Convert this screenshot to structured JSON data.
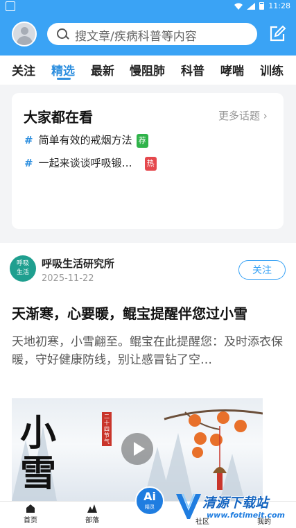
{
  "status_bar": {
    "time": "11:28"
  },
  "header": {
    "search_placeholder": "搜文章/疾病科普等内容",
    "icons": [
      "avatar",
      "search-icon",
      "edit-icon"
    ]
  },
  "tabs": [
    {
      "label": "关注",
      "active": false
    },
    {
      "label": "精选",
      "active": true
    },
    {
      "label": "最新",
      "active": false
    },
    {
      "label": "慢阻肺",
      "active": false
    },
    {
      "label": "科普",
      "active": false
    },
    {
      "label": "哮喘",
      "active": false
    },
    {
      "label": "训练",
      "active": false
    }
  ],
  "trending": {
    "title": "大家都在看",
    "more_label": "更多话题 ›",
    "topics": [
      {
        "hash": "#",
        "text": "简单有效的戒烟方法",
        "badge": "荐",
        "badge_color": "#2fb34a"
      },
      {
        "hash": "#",
        "text": "一起来谈谈呼吸锻…",
        "badge": "热",
        "badge_color": "#e5484d"
      }
    ]
  },
  "post": {
    "author_logo": "呼吸\n生活",
    "author": "呼吸生活研究所",
    "date": "2025-11-22",
    "follow_label": "关注",
    "title": "天渐寒，心要暖，鲲宝提醒伴您过小雪",
    "excerpt": "天地初寒，小雪翩至。鲲宝在此提醒您：及时添衣保暖，守好健康防线，别让感冒钻了空…",
    "image_calligraphy": "小雪",
    "image_stamp": "二十四节气"
  },
  "bottom_nav": {
    "items": [
      {
        "label": "首页"
      },
      {
        "label": "部落"
      },
      {
        "label": "社区"
      },
      {
        "label": "我的"
      }
    ],
    "ai_label": "Ai",
    "ai_sub": "精灵"
  },
  "watermark": {
    "title": "清源下载站",
    "url": "www.fotimeit.com"
  },
  "colors": {
    "brand": "#3aa3f5",
    "active_tab": "#2e8fdf"
  }
}
